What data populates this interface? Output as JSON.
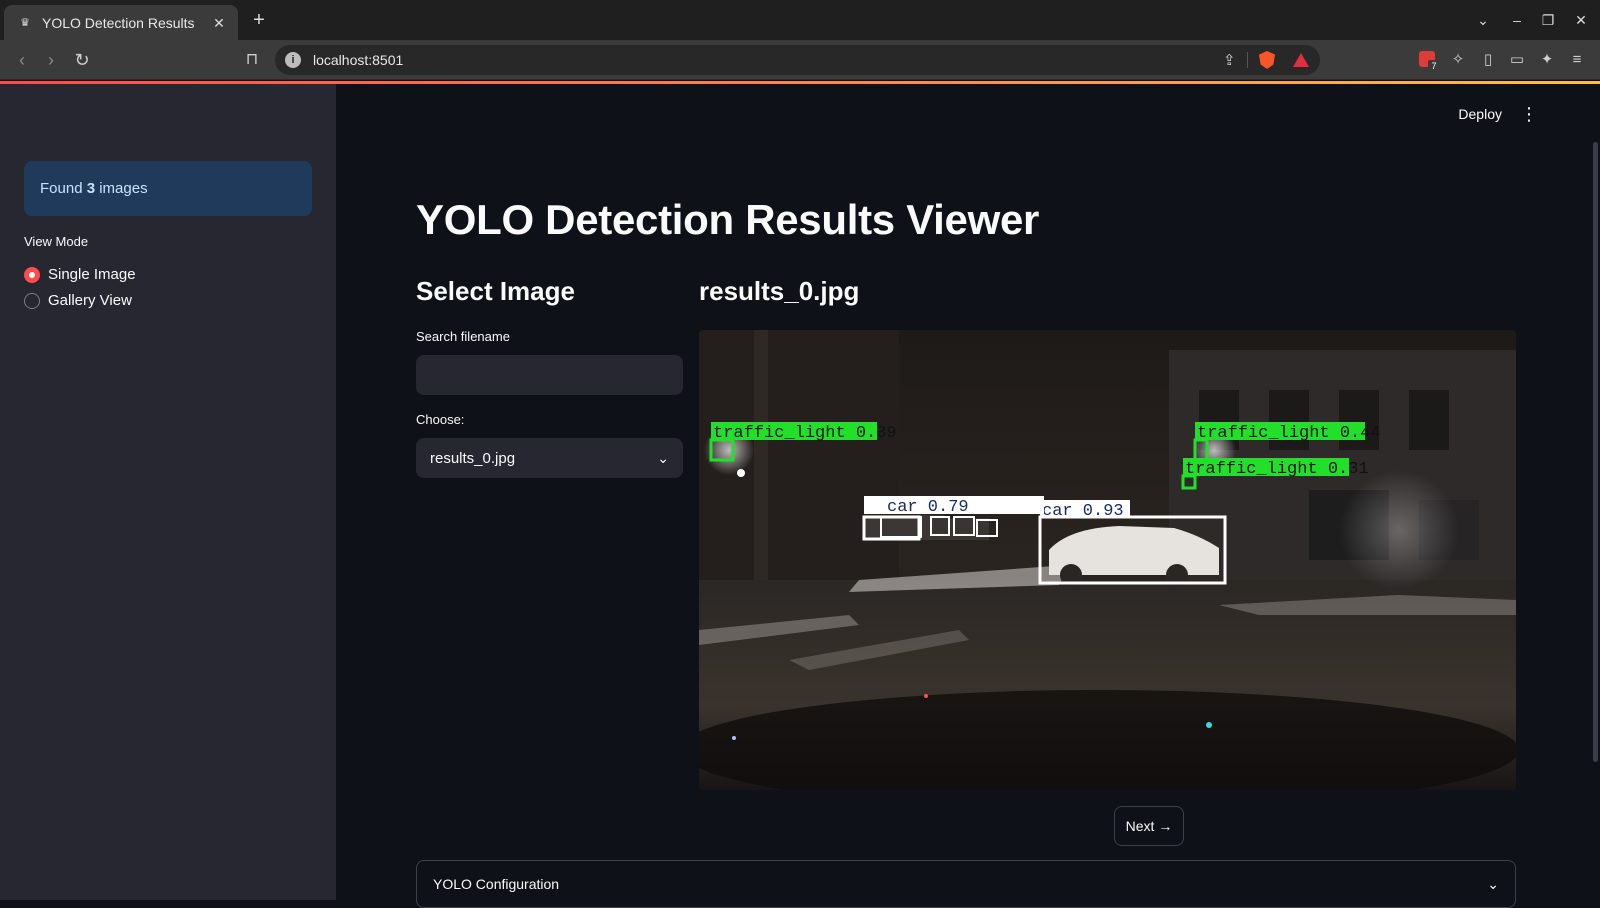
{
  "browser": {
    "tab_title": "YOLO Detection Results",
    "url": "localhost:8501",
    "extension_badge": "7"
  },
  "sidebar": {
    "info_prefix": "Found ",
    "info_count": "3",
    "info_suffix": " images",
    "view_mode_label": "View Mode",
    "options": [
      {
        "label": "Single Image",
        "selected": true
      },
      {
        "label": "Gallery View",
        "selected": false
      }
    ]
  },
  "header": {
    "deploy_label": "Deploy"
  },
  "main": {
    "title": "YOLO Detection Results Viewer",
    "select_section_title": "Select Image",
    "search_label": "Search filename",
    "search_value": "",
    "choose_label": "Choose:",
    "choose_value": "results_0.jpg",
    "image_title": "results_0.jpg",
    "next_label": "Next →",
    "expander_label": "YOLO Configuration"
  },
  "detections": [
    {
      "label": "traffic_light 0.39",
      "color": "#22e02a"
    },
    {
      "label": "traffic_light 0.44",
      "color": "#22e02a"
    },
    {
      "label": "traffic_light 0.31",
      "color": "#22e02a"
    },
    {
      "label": "car 0.93",
      "color": "#ffffff"
    },
    {
      "label": "car 0.79",
      "color": "#ffffff"
    }
  ],
  "colors": {
    "accent": "#ff4b4b",
    "sidebar_bg": "#262730",
    "app_bg": "#0e1117",
    "info_bg": "#1f3a5a",
    "info_text": "#c7e3ff"
  }
}
